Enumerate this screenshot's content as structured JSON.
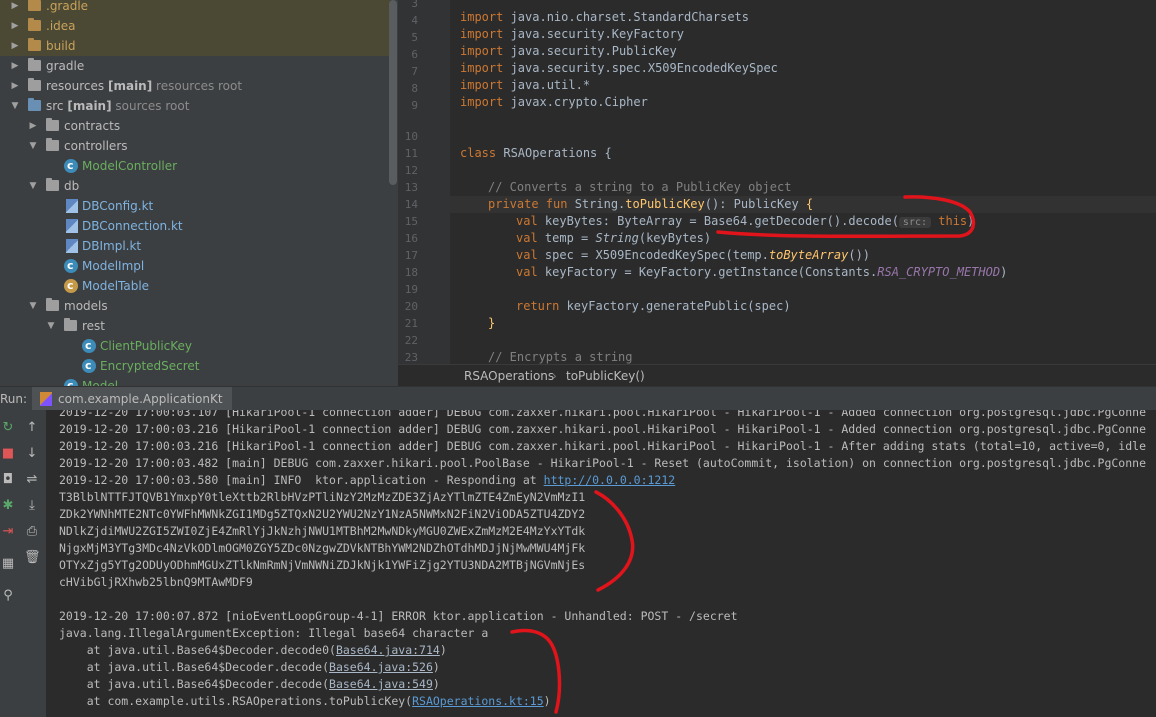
{
  "project_tree": {
    "items": [
      {
        "label": ".gradle",
        "extra": ""
      },
      {
        "label": ".idea",
        "extra": ""
      },
      {
        "label": "build",
        "extra": ""
      },
      {
        "label": "gradle",
        "extra": ""
      },
      {
        "label": "resources",
        "badge": "[main]",
        "extra": "resources root"
      },
      {
        "label": "src",
        "badge": "[main]",
        "extra": "sources root"
      },
      {
        "label": "contracts"
      },
      {
        "label": "controllers"
      },
      {
        "label": "ModelController"
      },
      {
        "label": "db"
      },
      {
        "label": "DBConfig.kt"
      },
      {
        "label": "DBConnection.kt"
      },
      {
        "label": "DBImpl.kt"
      },
      {
        "label": "ModelImpl"
      },
      {
        "label": "ModelTable"
      },
      {
        "label": "models"
      },
      {
        "label": "rest"
      },
      {
        "label": "ClientPublicKey"
      },
      {
        "label": "EncryptedSecret"
      },
      {
        "label": "Model"
      }
    ]
  },
  "editor": {
    "line_numbers": [
      "3",
      "4",
      "5",
      "6",
      "7",
      "8",
      "9",
      "10",
      "11",
      "12",
      "13",
      "14",
      "15",
      "16",
      "17",
      "18",
      "19",
      "20",
      "21",
      "22",
      "23"
    ],
    "lines": {
      "l4_kw": "import",
      "l4": " java.nio.charset.StandardCharsets",
      "l5_kw": "import",
      "l5": " java.security.KeyFactory",
      "l6_kw": "import",
      "l6": " java.security.PublicKey",
      "l7_kw": "import",
      "l7": " java.security.spec.X509EncodedKeySpec",
      "l8_kw": "import",
      "l8": " java.util.*",
      "l9_kw": "import",
      "l9": " javax.crypto.Cipher",
      "l12_kw": "class",
      "l12": " RSAOperations {",
      "l14": "// Converts a string to a PublicKey object",
      "l15_kw": "private fun",
      "l15_a": " String.",
      "l15_fn": "toPublicKey",
      "l15_b": "(): PublicKey ",
      "l15_brace": "{",
      "l16_kw": "val",
      "l16_a": " keyBytes: ByteArray = Base64.getDecoder().decode(",
      "l16_hint": "src:",
      "l16_this": "this",
      "l16_b": ")",
      "l17_kw": "val",
      "l17_a": " temp = ",
      "l17_it": "String",
      "l17_b": "(keyBytes)",
      "l18_kw": "val",
      "l18_a": " spec = X509EncodedKeySpec(temp.",
      "l18_fn": "toByteArray",
      "l18_b": "())",
      "l19_kw": "val",
      "l19_a": " keyFactory = KeyFactory.getInstance(Constants.",
      "l19_const": "RSA_CRYPTO_METHOD",
      "l19_b": ")",
      "l21_kw": "return",
      "l21": " keyFactory.generatePublic(spec)",
      "l22": "}",
      "l24": "// Encrypts a string"
    }
  },
  "breadcrumb": {
    "class": "RSAOperations",
    "separator": "›",
    "method": "toPublicKey()"
  },
  "run_bar": {
    "label": "Run:",
    "tab": "com.example.ApplicationKt"
  },
  "console": {
    "lines": [
      "2019-12-20 17:00:03.107 [HikariPool-1 connection adder] DEBUG com.zaxxer.hikari.pool.HikariPool - HikariPool-1 - Added connection org.postgresql.jdbc.PgConne",
      "2019-12-20 17:00:03.216 [HikariPool-1 connection adder] DEBUG com.zaxxer.hikari.pool.HikariPool - HikariPool-1 - Added connection org.postgresql.jdbc.PgConne",
      "2019-12-20 17:00:03.216 [HikariPool-1 connection adder] DEBUG com.zaxxer.hikari.pool.HikariPool - HikariPool-1 - After adding stats (total=10, active=0, idle",
      "2019-12-20 17:00:03.482 [main] DEBUG com.zaxxer.hikari.pool.PoolBase - HikariPool-1 - Reset (autoCommit, isolation) on connection org.postgresql.jdbc.PgConne"
    ],
    "responding_prefix": "2019-12-20 17:00:03.580 [main] INFO  ktor.application - Responding at ",
    "responding_url": "http://0.0.0.0:1212",
    "key_lines": [
      "T3BlblNTTFJTQVB1YmxpY0tleXttb2RlbHVzPTliNzY2MzMzZDE3ZjAzYTlmZTE4ZmEyN2VmMzI1",
      "ZDk2YWNhMTE2NTc0YWFhMWNkZGI1MDg5ZTQxN2U2YWU2NzY1NzA5NWMxN2FiN2ViODA5ZTU4ZDY2",
      "NDlkZjdiMWU2ZGI5ZWI0ZjE4ZmRlYjJkNzhjNWU1MTBhM2MwNDkyMGU0ZWExZmMzM2E4MzYxYTdk",
      "NjgxMjM3YTg3MDc4NzVkODlmOGM0ZGY5ZDc0NzgwZDVkNTBhYWM2NDZhOTdhMDJjNjMwMWU4MjFk",
      "OTYxZjg5YTg2ODUyODhmMGUxZTlkNmRmNjVmNWNiZDJkNjk1YWFiZjg2YTU3NDA2MTBjNGVmNjEs",
      "cHVibGljRXhwb25lbnQ9MTAwMDF9"
    ],
    "error_line": "2019-12-20 17:00:07.872 [nioEventLoopGroup-4-1] ERROR ktor.application - Unhandled: POST - /secret",
    "exception_line": "java.lang.IllegalArgumentException: Illegal base64 character a",
    "stack": [
      {
        "prefix": "    at java.util.Base64$Decoder.decode0(",
        "link": "Base64.java:714",
        "suffix": ")"
      },
      {
        "prefix": "    at java.util.Base64$Decoder.decode(",
        "link": "Base64.java:526",
        "suffix": ")"
      },
      {
        "prefix": "    at java.util.Base64$Decoder.decode(",
        "link": "Base64.java:549",
        "suffix": ")"
      },
      {
        "prefix": "    at com.example.utils.RSAOperations.toPublicKey(",
        "link": "RSAOperations.kt:15",
        "suffix": ")"
      }
    ]
  },
  "colors": {
    "keyword": "#cc7832",
    "comment": "#808080",
    "function": "#ffc66d",
    "link": "#5394ec",
    "annotation": "#e0141a"
  }
}
